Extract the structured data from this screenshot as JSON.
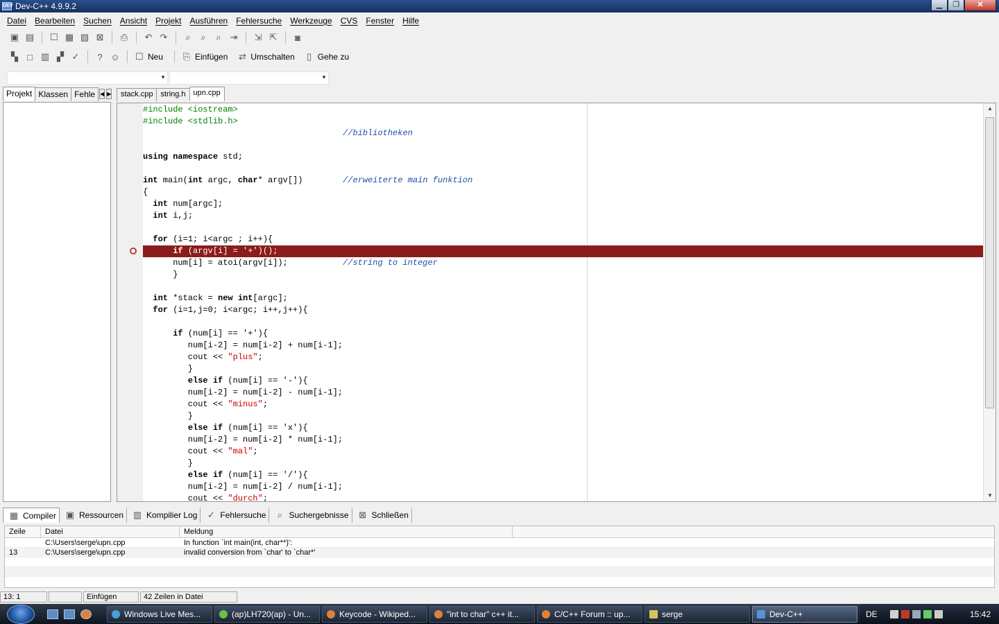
{
  "window": {
    "title": "Dev-C++ 4.9.9.2",
    "icon": "devcpp-icon",
    "minimize": "▁",
    "maximize": "❐",
    "close": "✕"
  },
  "menu": [
    "Datei",
    "Bearbeiten",
    "Suchen",
    "Ansicht",
    "Projekt",
    "Ausführen",
    "Fehlersuche",
    "Werkzeuge",
    "CVS",
    "Fenster",
    "Hilfe"
  ],
  "toolbar2": {
    "new_label": "Neu",
    "insert_label": "Einfügen",
    "toggle_label": "Umschalten",
    "goto_label": "Gehe zu"
  },
  "left_tabs": [
    "Projekt",
    "Klassen",
    "Fehle"
  ],
  "editor_tabs": [
    "stack.cpp",
    "string.h",
    "upn.cpp"
  ],
  "active_editor_tab": 2,
  "code": [
    [
      [
        "pp",
        "#include <iostream>"
      ]
    ],
    [
      [
        "pp",
        "#include <stdlib.h>"
      ]
    ],
    [
      [
        "t",
        "                                        "
      ],
      [
        "cm",
        "//bibliotheken"
      ]
    ],
    [
      [
        "t",
        ""
      ]
    ],
    [
      [
        "kw",
        "using namespace"
      ],
      [
        "t",
        " std;"
      ]
    ],
    [
      [
        "t",
        ""
      ]
    ],
    [
      [
        "kw",
        "int"
      ],
      [
        "t",
        " main("
      ],
      [
        "kw",
        "int"
      ],
      [
        "t",
        " argc, "
      ],
      [
        "kw",
        "char"
      ],
      [
        "t",
        "* argv[])        "
      ],
      [
        "cm",
        "//erweiterte main funktion"
      ]
    ],
    [
      [
        "t",
        "{"
      ]
    ],
    [
      [
        "t",
        "  "
      ],
      [
        "kw",
        "int"
      ],
      [
        "t",
        " num[argc];"
      ]
    ],
    [
      [
        "t",
        "  "
      ],
      [
        "kw",
        "int"
      ],
      [
        "t",
        " i,j;"
      ]
    ],
    [
      [
        "t",
        ""
      ]
    ],
    [
      [
        "t",
        "  "
      ],
      [
        "kw",
        "for"
      ],
      [
        "t",
        " (i=1; i<argc ; i++){"
      ]
    ],
    [
      [
        "t",
        "      "
      ],
      [
        "kw",
        "if"
      ],
      [
        "t",
        " (argv[i] = '+')();"
      ]
    ],
    [
      [
        "t",
        "      num[i] = atoi(argv[i]);           "
      ],
      [
        "cm",
        "//string to integer"
      ]
    ],
    [
      [
        "t",
        "      }"
      ]
    ],
    [
      [
        "t",
        ""
      ]
    ],
    [
      [
        "t",
        "  "
      ],
      [
        "kw",
        "int"
      ],
      [
        "t",
        " *stack = "
      ],
      [
        "kw",
        "new int"
      ],
      [
        "t",
        "[argc];"
      ]
    ],
    [
      [
        "t",
        "  "
      ],
      [
        "kw",
        "for"
      ],
      [
        "t",
        " (i=1,j=0; i<argc; i++,j++){"
      ]
    ],
    [
      [
        "t",
        ""
      ]
    ],
    [
      [
        "t",
        "      "
      ],
      [
        "kw",
        "if"
      ],
      [
        "t",
        " (num[i] == '+'){"
      ]
    ],
    [
      [
        "t",
        "         num[i-2] = num[i-2] + num[i-1];"
      ]
    ],
    [
      [
        "t",
        "         cout << "
      ],
      [
        "str",
        "\"plus\""
      ],
      [
        "t",
        ";"
      ]
    ],
    [
      [
        "t",
        "         }"
      ]
    ],
    [
      [
        "t",
        "         "
      ],
      [
        "kw",
        "else if"
      ],
      [
        "t",
        " (num[i] == '-'){"
      ]
    ],
    [
      [
        "t",
        "         num[i-2] = num[i-2] - num[i-1];"
      ]
    ],
    [
      [
        "t",
        "         cout << "
      ],
      [
        "str",
        "\"minus\""
      ],
      [
        "t",
        ";"
      ]
    ],
    [
      [
        "t",
        "         }"
      ]
    ],
    [
      [
        "t",
        "         "
      ],
      [
        "kw",
        "else if"
      ],
      [
        "t",
        " (num[i] == 'x'){"
      ]
    ],
    [
      [
        "t",
        "         num[i-2] = num[i-2] * num[i-1];"
      ]
    ],
    [
      [
        "t",
        "         cout << "
      ],
      [
        "str",
        "\"mal\""
      ],
      [
        "t",
        ";"
      ]
    ],
    [
      [
        "t",
        "         }"
      ]
    ],
    [
      [
        "t",
        "         "
      ],
      [
        "kw",
        "else if"
      ],
      [
        "t",
        " (num[i] == '/'){"
      ]
    ],
    [
      [
        "t",
        "         num[i-2] = num[i-2] / num[i-1];"
      ]
    ],
    [
      [
        "t",
        "         cout << "
      ],
      [
        "str",
        "\"durch\""
      ],
      [
        "t",
        ";"
      ]
    ]
  ],
  "error_line_index": 12,
  "bottom_tabs": [
    {
      "label": "Compiler",
      "icon": "compiler-grid-icon"
    },
    {
      "label": "Ressourcen",
      "icon": "resources-icon"
    },
    {
      "label": "Kompilier Log",
      "icon": "log-chart-icon"
    },
    {
      "label": "Fehlersuche",
      "icon": "check-icon"
    },
    {
      "label": "Suchergebnisse",
      "icon": "search-results-icon"
    },
    {
      "label": "Schließen",
      "icon": "close-panel-icon"
    }
  ],
  "messages": {
    "columns": [
      "Zeile",
      "Datei",
      "Meldung"
    ],
    "rows": [
      {
        "line": "",
        "file": "C:\\Users\\serge\\upn.cpp",
        "message": "In function `int main(int, char**)':"
      },
      {
        "line": "13",
        "file": "C:\\Users\\serge\\upn.cpp",
        "message": "invalid conversion from `char' to `char*'"
      }
    ]
  },
  "status": {
    "position": "13: 1",
    "blank": "",
    "mode": "Einfügen",
    "lines": "42 Zeilen in Datei"
  },
  "taskbar": {
    "tasks": [
      "Windows Live Mes...",
      "(ap)LH720(ap) - Un...",
      "Keycode - Wikiped...",
      "\"int to char\" c++ it...",
      "C/C++ Forum :: up...",
      "serge",
      "Dev-C++"
    ],
    "lang": "DE",
    "clock": "15:42"
  }
}
